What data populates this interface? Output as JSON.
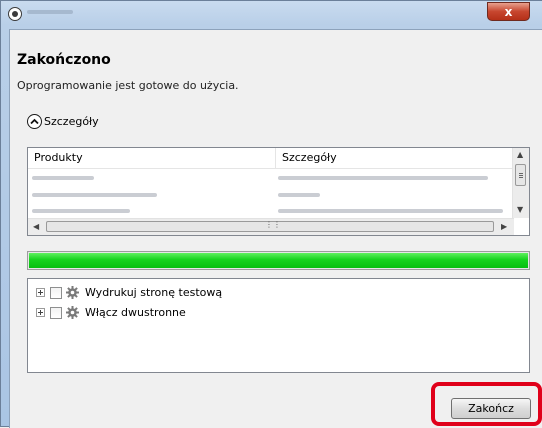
{
  "window": {
    "title": "",
    "close_label": "x"
  },
  "header": {
    "title": "Zakończono",
    "subtitle": "Oprogramowanie jest gotowe do użycia."
  },
  "details_toggle": {
    "label": "Szczegóły",
    "icon": "chevron-up-icon"
  },
  "details_list": {
    "columns": [
      "Produkty",
      "Szczegóły"
    ],
    "rows_count_note": ""
  },
  "progress": {
    "value_percent": 100,
    "color": "#16d31e"
  },
  "options": [
    {
      "label": "Wydrukuj stronę testową",
      "checked": false
    },
    {
      "label": "Włącz dwustronne",
      "checked": false
    }
  ],
  "footer": {
    "finish_label": "Zakończ"
  },
  "colors": {
    "highlight": "#e0001a",
    "close_button": "#c7462f"
  }
}
